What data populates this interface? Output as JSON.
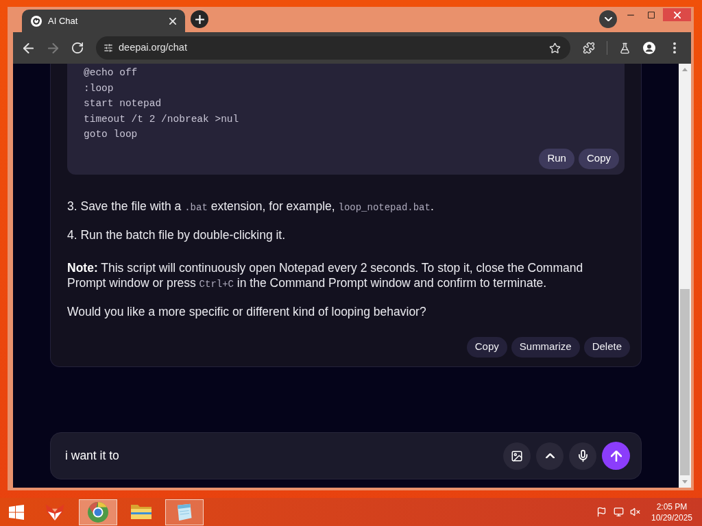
{
  "browser": {
    "tabs": [
      {
        "title": "AI Chat",
        "selected": true
      }
    ],
    "nav": [
      {
        "kind": "back",
        "disabled": false
      },
      {
        "kind": "forward",
        "disabled": true
      },
      {
        "kind": "reload",
        "disabled": false
      }
    ],
    "address": "deepai.org/chat"
  },
  "chat": {
    "message": {
      "code": {
        "lines": [
          "@echo off",
          ":loop",
          "start notepad",
          "timeout /t 2 /nobreak >nul",
          "goto loop"
        ],
        "actions": [
          "Run",
          "Copy"
        ]
      },
      "paragraphs": [
        {
          "kind": "list_item",
          "parts": [
            {
              "kind": "text",
              "text": "3. Save the file with a "
            },
            {
              "kind": "code",
              "text": ".bat"
            },
            {
              "kind": "text",
              "text": " extension, for example, "
            },
            {
              "kind": "code",
              "text": "loop_notepad.bat"
            },
            {
              "kind": "text",
              "text": "."
            }
          ]
        },
        {
          "kind": "list_item",
          "parts": [
            {
              "kind": "text",
              "text": "4. Run the batch file by double-clicking it."
            }
          ]
        },
        {
          "kind": "note",
          "parts": [
            {
              "kind": "bold",
              "text": "Note:"
            },
            {
              "kind": "text",
              "text": " This script will continuously open Notepad every 2 seconds. To stop it, close the Command Prompt window or press "
            },
            {
              "kind": "code",
              "text": "Ctrl+C"
            },
            {
              "kind": "text",
              "text": " in the Command Prompt window and confirm to terminate."
            }
          ]
        },
        {
          "kind": "text",
          "parts": [
            {
              "kind": "text",
              "text": "Would you like a more specific or different kind of looping behavior?"
            }
          ]
        }
      ],
      "actions": [
        "Copy",
        "Summarize",
        "Delete"
      ]
    },
    "composer": {
      "value": "i want it to"
    }
  },
  "taskbar": {
    "apps": [
      {
        "kind": "fox",
        "running": false,
        "selected": false
      },
      {
        "kind": "browser",
        "running": true,
        "selected": true
      },
      {
        "kind": "folder",
        "running": false,
        "selected": false
      },
      {
        "kind": "notepad",
        "running": true,
        "selected": false
      }
    ],
    "clock": {
      "time": "2:05 PM",
      "date": "10/29/2025"
    }
  }
}
